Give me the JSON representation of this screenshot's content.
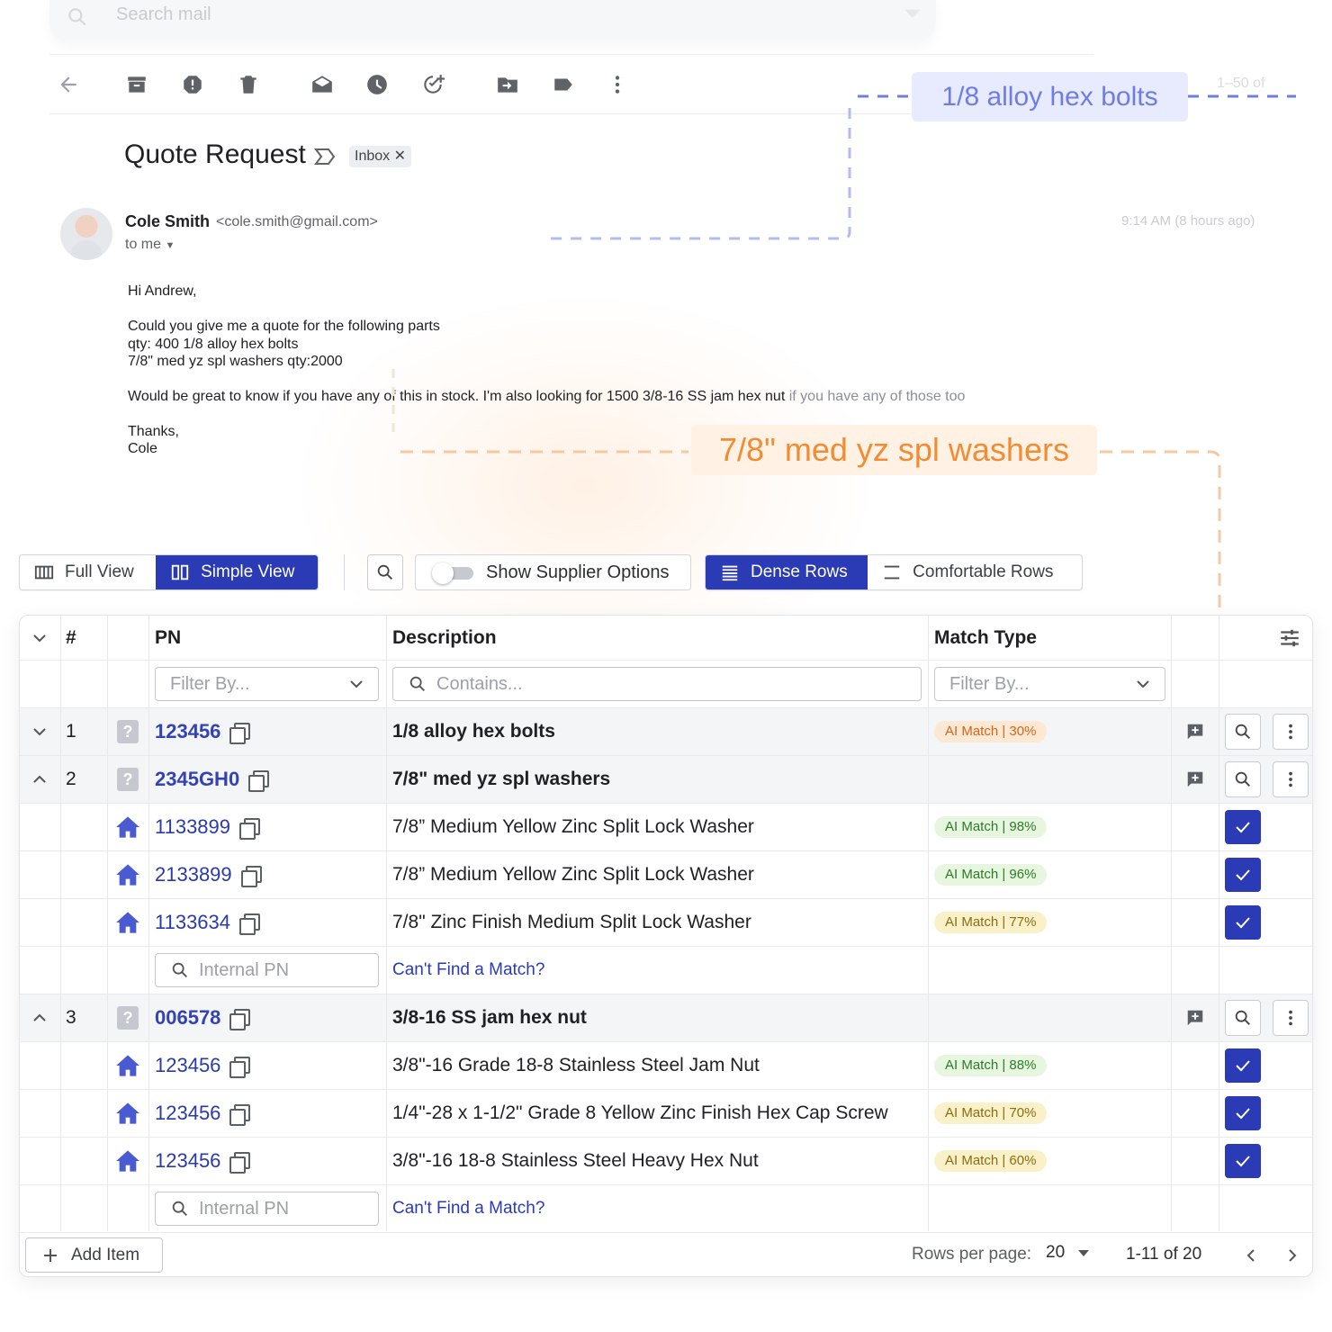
{
  "colors": {
    "primary": "#2a3bb5",
    "callout_blue": "#6f7de3",
    "callout_orange": "#f28c33"
  },
  "email": {
    "search_placeholder": "Search mail",
    "pager_ghost": "1–50 of",
    "subject": "Quote Request",
    "label_chip": "Inbox",
    "sender_name": "Cole Smith",
    "sender_email": "<cole.smith@gmail.com>",
    "to_line": "to me",
    "timestamp": "9:14 AM (8 hours ago)",
    "greeting": "Hi Andrew,",
    "line1": "Could you give me a quote for the following parts",
    "line2": "qty: 400  1/8 alloy hex bolts",
    "line3": "7/8\" med yz spl washers qty:2000",
    "line4a": "Would be great to know if you have any of this in stock. I'm also looking for 1500 3/8-16 SS jam hex nut ",
    "line4b": "if you have any of those too",
    "sign1": "Thanks,",
    "sign2": "Cole"
  },
  "callouts": {
    "blue": "1/8 alloy hex bolts",
    "orange": "7/8\" med yz spl washers"
  },
  "toolbar": {
    "full_view": "Full View",
    "simple_view": "Simple View",
    "show_supplier": "Show Supplier Options",
    "dense_rows": "Dense Rows",
    "comfortable_rows": "Comfortable Rows"
  },
  "table": {
    "col_num": "#",
    "col_pn": "PN",
    "col_desc": "Description",
    "col_match": "Match Type",
    "filter_pn": "Filter By...",
    "filter_desc": "Contains...",
    "filter_match": "Filter By...",
    "internal_pn_placeholder": "Internal PN",
    "cant_find": "Can't Find a Match?",
    "items": [
      {
        "num": "1",
        "pn": "123456",
        "desc": "1/8 alloy hex bolts",
        "match": "AI Match | 30%"
      },
      {
        "num": "2",
        "pn": "2345GH0",
        "desc": "7/8\" med yz spl washers",
        "match": "",
        "subs": [
          {
            "pn": "1133899",
            "desc": "7/8” Medium Yellow Zinc Split Lock Washer",
            "match": "AI Match | 98%"
          },
          {
            "pn": "2133899",
            "desc": "7/8” Medium Yellow Zinc Split Lock Washer",
            "match": "AI Match | 96%"
          },
          {
            "pn": "1133634",
            "desc": "7/8\" Zinc Finish Medium Split Lock Washer",
            "match": "AI Match | 77%"
          }
        ]
      },
      {
        "num": "3",
        "pn": "006578",
        "desc": "3/8-16 SS jam hex nut",
        "match": "",
        "subs": [
          {
            "pn": "123456",
            "desc": "3/8\"-16 Grade 18-8 Stainless Steel Jam Nut",
            "match": "AI Match | 88%"
          },
          {
            "pn": "123456",
            "desc": "1/4\"-28 x 1-1/2\" Grade 8 Yellow Zinc Finish Hex Cap Screw",
            "match": "AI Match | 70%"
          },
          {
            "pn": "123456",
            "desc": "3/8\"-16 18-8 Stainless Steel Heavy Hex Nut",
            "match": "AI Match | 60%"
          }
        ]
      }
    ]
  },
  "footer": {
    "add_item": "Add Item",
    "rows_per_page_label": "Rows per page:",
    "rows_per_page_value": "20",
    "range": "1-11 of 20"
  }
}
